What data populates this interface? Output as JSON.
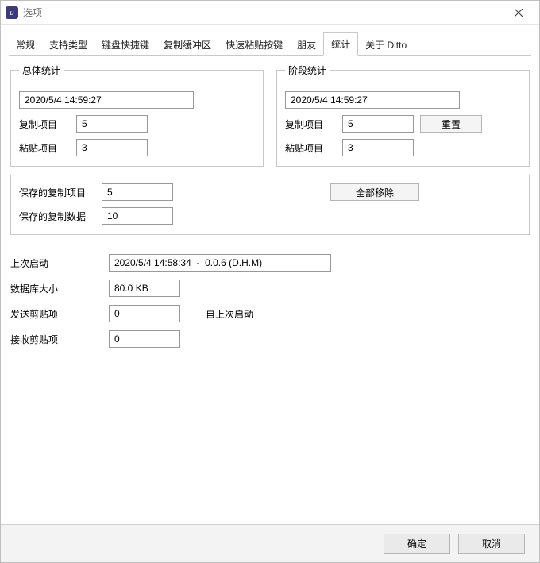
{
  "window": {
    "title": "选项",
    "close_icon": "close-icon"
  },
  "tabs": [
    {
      "label": "常规"
    },
    {
      "label": "支持类型"
    },
    {
      "label": "键盘快捷键"
    },
    {
      "label": "复制缓冲区"
    },
    {
      "label": "快速粘贴按键"
    },
    {
      "label": "朋友"
    },
    {
      "label": "统计"
    },
    {
      "label": "关于 Ditto"
    }
  ],
  "overall": {
    "legend": "总体统计",
    "date": "2020/5/4 14:59:27",
    "copy_label": "复制项目",
    "copy_value": "5",
    "paste_label": "粘贴项目",
    "paste_value": "3"
  },
  "phase": {
    "legend": "阶段统计",
    "date": "2020/5/4 14:59:27",
    "copy_label": "复制项目",
    "copy_value": "5",
    "paste_label": "粘贴项目",
    "paste_value": "3",
    "reset_label": "重置"
  },
  "saved": {
    "copy_items_label": "保存的复制项目",
    "copy_items_value": "5",
    "copy_data_label": "保存的复制数据",
    "copy_data_value": "10",
    "remove_all_label": "全部移除"
  },
  "info": {
    "last_start_label": "上次启动",
    "last_start_value": "2020/5/4 14:58:34  -  0.0.6 (D.H.M)",
    "db_size_label": "数据库大小",
    "db_size_value": "80.0 KB",
    "send_label": "发送剪贴项",
    "send_value": "0",
    "recv_label": "接收剪贴项",
    "recv_value": "0",
    "since_last_start": "自上次启动"
  },
  "buttons": {
    "ok": "确定",
    "cancel": "取消"
  }
}
